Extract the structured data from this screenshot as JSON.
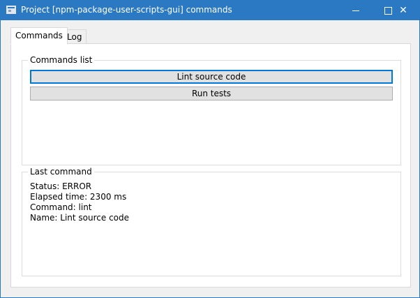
{
  "window": {
    "title": "Project [npm-package-user-scripts-gui] commands",
    "minimize_icon": "minimize-icon",
    "maximize_icon": "maximize-icon",
    "close_glyph": "✕",
    "accent": "#2b79c2"
  },
  "tabs": [
    {
      "label": "Commands",
      "active": true
    },
    {
      "label": "Log",
      "active": false
    }
  ],
  "commands_list": {
    "legend": "Commands list",
    "buttons": [
      {
        "label": "Lint source code",
        "focused": true
      },
      {
        "label": "Run tests",
        "focused": false
      }
    ]
  },
  "last_command": {
    "legend": "Last command",
    "status": "Status: ERROR",
    "elapsed": "Elapsed time: 2300 ms",
    "command": "Command: lint",
    "name": "Name: Lint source code"
  }
}
